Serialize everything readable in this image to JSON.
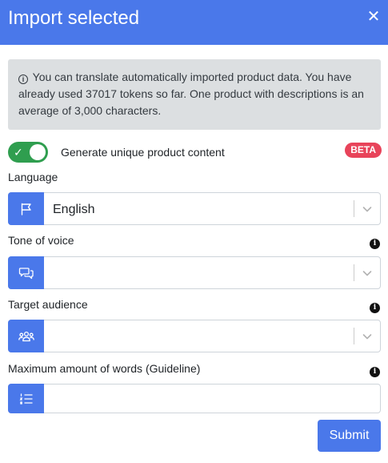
{
  "header": {
    "title": "Import selected",
    "close_icon": "close-icon"
  },
  "info": {
    "icon": "info-circle-icon",
    "text": "You can translate automatically imported product data. You have already used 37017 tokens so far. One product with descriptions is an average of 3,000 characters."
  },
  "unique_content": {
    "label": "Generate unique product content",
    "enabled": true,
    "badge": "BETA"
  },
  "language": {
    "label": "Language",
    "value": "English",
    "icon": "flag-icon"
  },
  "tone": {
    "label": "Tone of voice",
    "value": "",
    "icon": "chat-bubbles-icon"
  },
  "audience": {
    "label": "Target audience",
    "value": "",
    "icon": "users-icon"
  },
  "max_words": {
    "label": "Maximum amount of words (Guideline)",
    "value": "",
    "icon": "list-icon"
  },
  "submit": {
    "label": "Submit"
  },
  "colors": {
    "primary": "#4a78ea",
    "toggle_on": "#2f9e4f",
    "badge": "#e8435a",
    "info_bg": "#dcdfe1"
  }
}
